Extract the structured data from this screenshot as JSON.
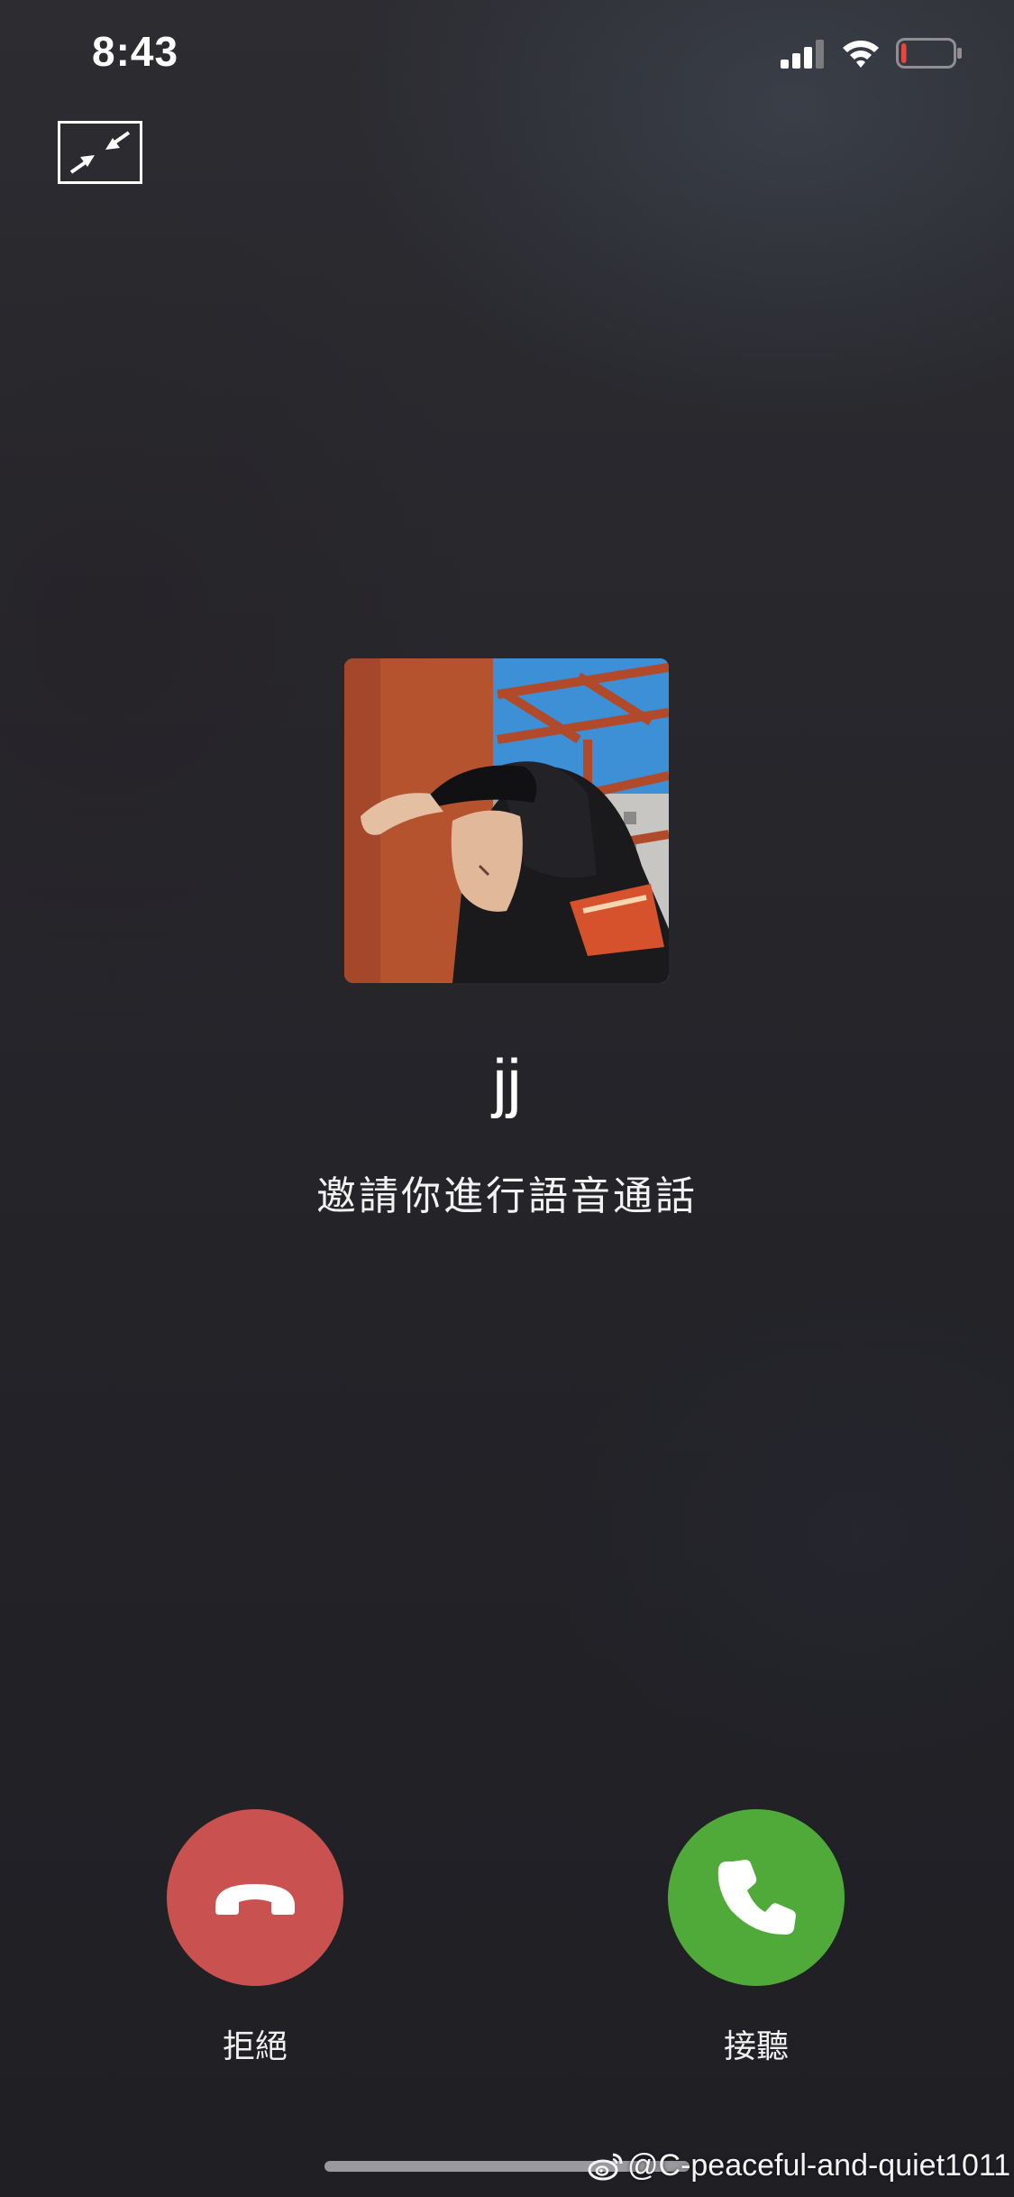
{
  "status_bar": {
    "time": "8:43",
    "signal_icon": "cellular-signal-icon",
    "wifi_icon": "wifi-icon",
    "battery_icon": "battery-low-icon",
    "battery_level": 0.1,
    "battery_color": "#e2493f"
  },
  "call": {
    "minimize_icon": "minimize-arrows-icon",
    "caller_name": "jj",
    "subtitle": "邀請你進行語音通話",
    "avatar": "caller-avatar-photo"
  },
  "actions": {
    "decline_label": "拒絕",
    "decline_icon": "hang-up-phone-icon",
    "decline_color": "#c9514f",
    "accept_label": "接聽",
    "accept_icon": "phone-icon",
    "accept_color": "#4faa39"
  },
  "watermark": {
    "icon": "weibo-icon",
    "text": "@C-peaceful-and-quiet1011"
  }
}
